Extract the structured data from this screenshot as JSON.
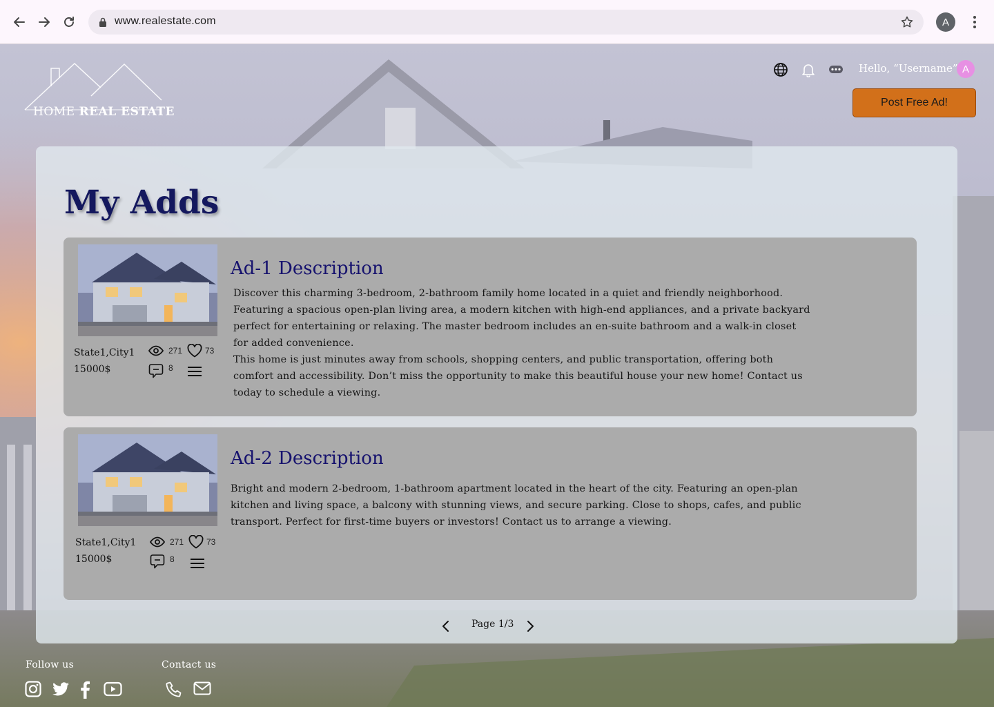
{
  "browser": {
    "url": "www.realestate.com",
    "profile_initial": "A"
  },
  "header": {
    "logo_text_regular": "HOME ",
    "logo_text_bold": "REAL ESTATE",
    "greeting": "Hello, “Username”",
    "avatar_initial": "A",
    "post_button": "Post Free Ad!"
  },
  "main": {
    "title": "My Adds",
    "ads": [
      {
        "title": "Ad-1 Description",
        "location": "State1,City1",
        "price": "15000$",
        "views": "271",
        "likes": "73",
        "comments": "8",
        "description": [
          "Discover this charming 3-bedroom, 2-bathroom family home located in a quiet and friendly neighborhood.",
          "Featuring a spacious open-plan living area, a modern kitchen with high-end appliances, and a private backyard",
          "perfect for entertaining or relaxing. The master bedroom includes an en-suite bathroom and a walk-in closet",
          "for added convenience.",
          "This home is just minutes away from schools, shopping centers, and public transportation, offering both",
          "comfort and accessibility. Don’t miss the opportunity to make this beautiful house your new home! Contact us",
          "today to schedule a viewing."
        ]
      },
      {
        "title": "Ad-2 Description",
        "location": "State1,City1",
        "price": "15000$",
        "views": "271",
        "likes": "73",
        "comments": "8",
        "description": [
          "Bright and modern 2-bedroom, 1-bathroom apartment located in the heart of the city. Featuring an open-plan",
          "kitchen and living space, a balcony with stunning views, and secure parking. Close to shops, cafes, and public",
          "transport. Perfect for first-time buyers or investors! Contact us to arrange a viewing."
        ]
      }
    ],
    "pager": "Page 1/3"
  },
  "footer": {
    "follow_label": "Follow us",
    "contact_label": "Contact us",
    "social_icons": [
      "instagram-icon",
      "twitter-icon",
      "facebook-icon",
      "youtube-icon"
    ],
    "contact_icons": [
      "phone-icon",
      "mail-icon"
    ]
  },
  "colors": {
    "accent_button": "#d2701a",
    "title_navy": "#14185e",
    "avatar_pink": "#e790e3",
    "card_gray": "#ababab"
  }
}
